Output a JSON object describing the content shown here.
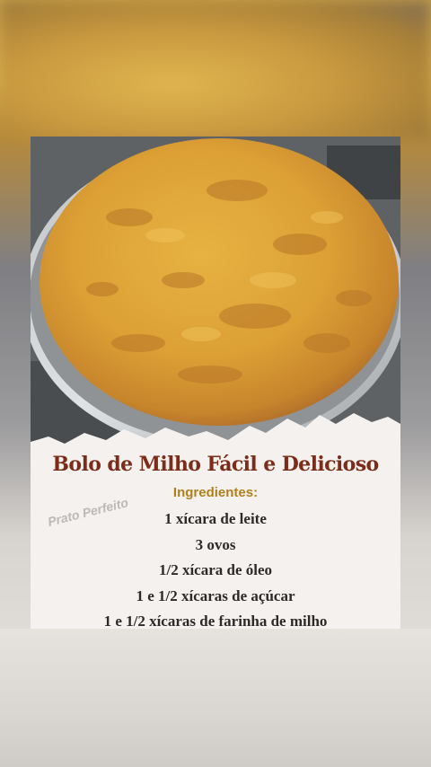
{
  "recipe": {
    "title": "Bolo de Milho Fácil e Delicioso",
    "section_label": "Ingredientes:",
    "ingredients": [
      "1 xícara de leite",
      "3 ovos",
      "1/2 xícara de óleo",
      "1 e 1/2 xícaras de açúcar",
      "1 e 1/2 xícaras de farinha de milho"
    ],
    "watermark": "Prato Perfeito"
  },
  "colors": {
    "title": "#7b2d1a",
    "subtitle": "#b0801e",
    "text": "#2e2a27",
    "cake": "#e0a637",
    "crust": "#b8722a",
    "paper": "#f4f1ee"
  }
}
